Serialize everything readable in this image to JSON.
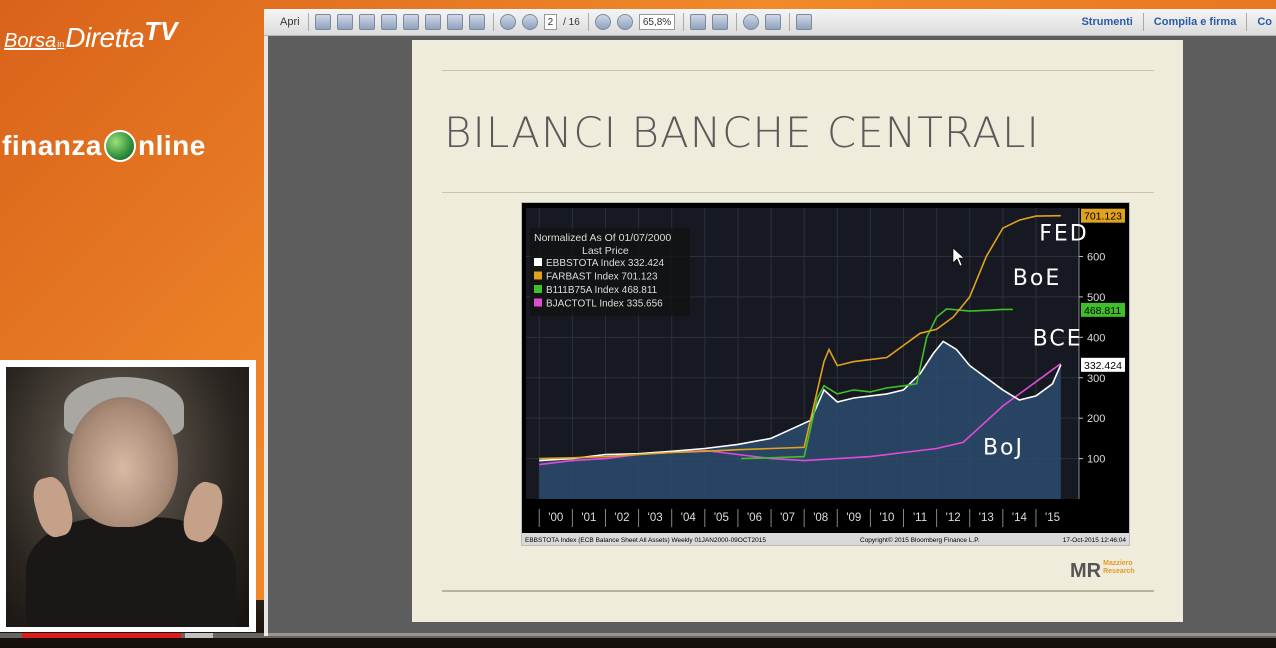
{
  "branding": {
    "borsa": "Borsa",
    "in": "in",
    "diretta": "Diretta",
    "tv": "TV",
    "finanza_left": "finanza",
    "finanza_right": "nline"
  },
  "viewer": {
    "open_label": "Apri",
    "page_current": "2",
    "page_total": "/ 16",
    "zoom": "65,8%",
    "tools_label": "Strumenti",
    "fill_sign_label": "Compila e firma",
    "comment_label": "Co"
  },
  "slide": {
    "title": "BILANCI BANCHE CENTRALI",
    "logo": "MR",
    "logo_sub1": "Mazziero",
    "logo_sub2": "Research"
  },
  "video": {
    "progress": 0.127
  },
  "chart_data": {
    "type": "line",
    "legend_header": "Normalized As Of 01/07/2000",
    "legend_subheader": "Last Price",
    "series": [
      {
        "name": "EBBSTOTA Index",
        "last": "332.424",
        "color": "#ffffff",
        "x": [
          2000,
          2001,
          2002,
          2003,
          2004,
          2005,
          2006,
          2007,
          2007.8,
          2008.2,
          2008.6,
          2009,
          2009.5,
          2010,
          2010.5,
          2011,
          2011.5,
          2011.9,
          2012.2,
          2012.6,
          2013,
          2013.5,
          2014,
          2014.5,
          2015,
          2015.5,
          2015.75
        ],
        "y": [
          95,
          100,
          110,
          112,
          118,
          125,
          135,
          150,
          180,
          195,
          270,
          240,
          250,
          255,
          260,
          270,
          310,
          360,
          390,
          370,
          330,
          300,
          270,
          245,
          255,
          285,
          332
        ]
      },
      {
        "name": "FARBAST Index",
        "last": "701.123",
        "color": "#e0a21c",
        "x": [
          2000,
          2001,
          2002,
          2003,
          2004,
          2005,
          2006,
          2007,
          2008,
          2008.6,
          2008.75,
          2009,
          2009.5,
          2010,
          2010.5,
          2011,
          2011.5,
          2012,
          2012.5,
          2013,
          2013.5,
          2014,
          2014.5,
          2015,
          2015.75
        ],
        "y": [
          100,
          102,
          105,
          110,
          115,
          118,
          122,
          125,
          128,
          340,
          370,
          330,
          340,
          345,
          350,
          380,
          410,
          420,
          450,
          500,
          600,
          670,
          690,
          700,
          701
        ]
      },
      {
        "name": "B111B75A Index",
        "last": "468.811",
        "color": "#3fbf2a",
        "x": [
          2006.1,
          2007,
          2008,
          2008.4,
          2008.6,
          2009,
          2009.5,
          2010,
          2010.5,
          2011,
          2011.4,
          2011.7,
          2012,
          2012.3,
          2012.6,
          2013,
          2013.5,
          2014,
          2014.3
        ],
        "y": [
          100,
          102,
          105,
          250,
          280,
          260,
          270,
          265,
          275,
          280,
          285,
          400,
          450,
          470,
          468,
          465,
          467,
          469,
          469
        ]
      },
      {
        "name": "BJACTOTL Index",
        "last": "335.656",
        "color": "#e04bd6",
        "x": [
          2000,
          2001,
          2002,
          2003,
          2004,
          2005,
          2006,
          2007,
          2008,
          2009,
          2010,
          2011,
          2012,
          2012.8,
          2013.2,
          2013.6,
          2014,
          2014.5,
          2015,
          2015.5,
          2015.75
        ],
        "y": [
          85,
          95,
          100,
          110,
          115,
          120,
          110,
          100,
          95,
          100,
          105,
          115,
          125,
          140,
          170,
          200,
          230,
          260,
          290,
          320,
          335
        ]
      }
    ],
    "y_ticks": [
      100,
      200,
      300,
      400,
      500,
      600
    ],
    "ylim": [
      0,
      720
    ],
    "xlim": [
      1999.6,
      2016.3
    ],
    "x_labels": [
      "'00",
      "'01",
      "'02",
      "'03",
      "'04",
      "'05",
      "'06",
      "'07",
      "'08",
      "'09",
      "'10",
      "'11",
      "'12",
      "'13",
      "'14",
      "'15"
    ],
    "last_value_tags": [
      {
        "text": "701.123",
        "value": 701,
        "color": "#e0a21c"
      },
      {
        "text": "468.811",
        "value": 468,
        "color": "#3fbf2a"
      },
      {
        "text": "332.424",
        "value": 332,
        "color": "#ffffff"
      }
    ],
    "annotations": [
      {
        "text": "FED",
        "x": 2015.1,
        "y": 640
      },
      {
        "text": "BoE",
        "x": 2014.3,
        "y": 530
      },
      {
        "text": "BCE",
        "x": 2014.9,
        "y": 380
      },
      {
        "text": "BoJ",
        "x": 2013.4,
        "y": 110
      }
    ],
    "footer_left": "EBBSTOTA Index (ECB Balance Sheet All Assets)  Weekly 01JAN2000-09OCT2015",
    "footer_mid": "Copyright© 2015 Bloomberg Finance L.P.",
    "footer_right": "17-Oct-2015 12:46:04"
  }
}
